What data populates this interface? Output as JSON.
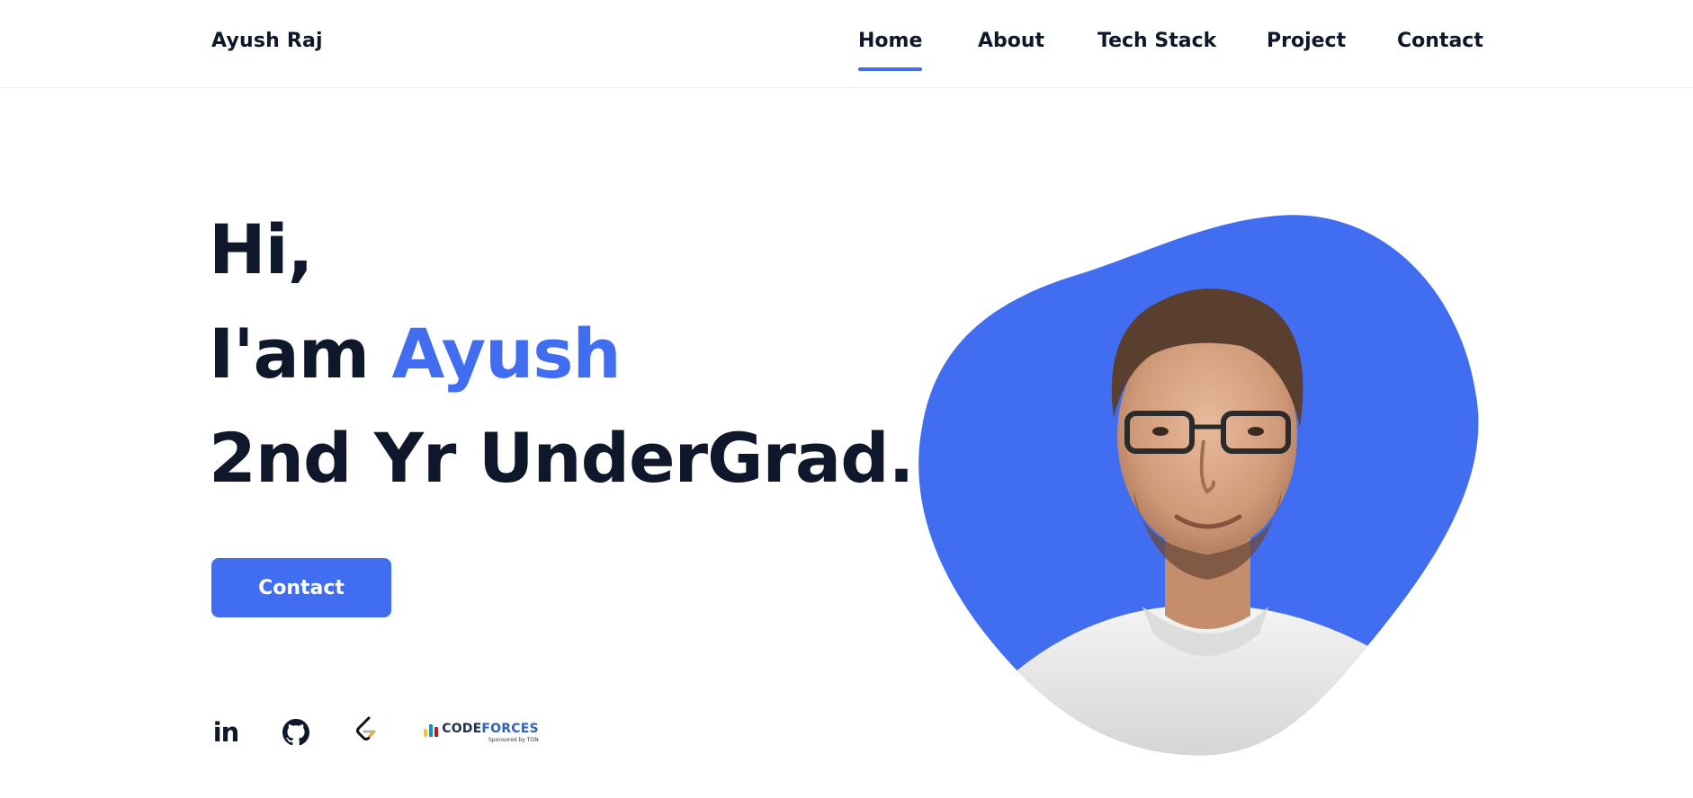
{
  "brand": {
    "name": "Ayush Raj"
  },
  "nav": {
    "items": [
      {
        "label": "Home",
        "active": true
      },
      {
        "label": "About",
        "active": false
      },
      {
        "label": "Tech Stack",
        "active": false
      },
      {
        "label": "Project",
        "active": false
      },
      {
        "label": "Contact",
        "active": false
      }
    ]
  },
  "hero": {
    "greeting": "Hi,",
    "intro_prefix": "I'am ",
    "name": "Ayush",
    "role": "2nd Yr UnderGrad.",
    "cta_label": "Contact"
  },
  "social": {
    "linkedin": {
      "icon": "linkedin-icon",
      "glyph": "in"
    },
    "github": {
      "icon": "github-icon"
    },
    "leetcode": {
      "icon": "leetcode-icon"
    },
    "codeforces": {
      "icon": "codeforces-logo",
      "wordmark_dark": "CODE",
      "wordmark_blue": "FORCES",
      "tagline": "Sponsored by TON"
    }
  },
  "colors": {
    "accent": "#416ef0",
    "text": "#0f172a",
    "background": "#ffffff"
  }
}
